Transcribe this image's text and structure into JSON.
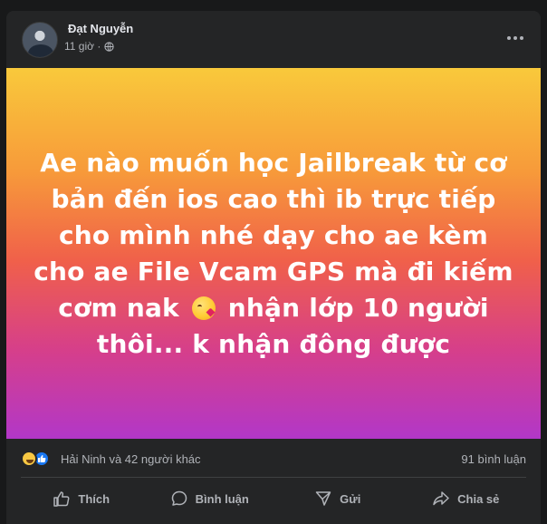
{
  "post": {
    "author": "Đạt Nguyễn",
    "time": "11 giờ ·",
    "privacy_icon": "globe-icon",
    "text_part1": "Ae nào muốn học Jailbreak từ cơ bản đến ios cao thì ib trực tiếp cho mình nhé dạy cho ae kèm cho ae File Vcam GPS mà đi kiếm cơm nak",
    "emoji": "face-blowing-kiss-emoji",
    "text_part2": "nhận lớp 10 người thôi... k nhận đông được",
    "background_gradient": [
      "#f9c93b",
      "#f0604a",
      "#b237c8"
    ]
  },
  "stats": {
    "reactions_text": "Hải Ninh và 42 người khác",
    "comments_text": "91 bình luận",
    "reaction_icons": [
      "haha-reaction-icon",
      "like-reaction-icon"
    ]
  },
  "actions": {
    "like": "Thích",
    "comment": "Bình luận",
    "send": "Gửi",
    "share": "Chia sẻ"
  },
  "colors": {
    "card_bg": "#242526",
    "page_bg": "#18191a",
    "text_primary": "#e4e6eb",
    "text_secondary": "#b0b3b8",
    "like_blue": "#1877f2"
  }
}
